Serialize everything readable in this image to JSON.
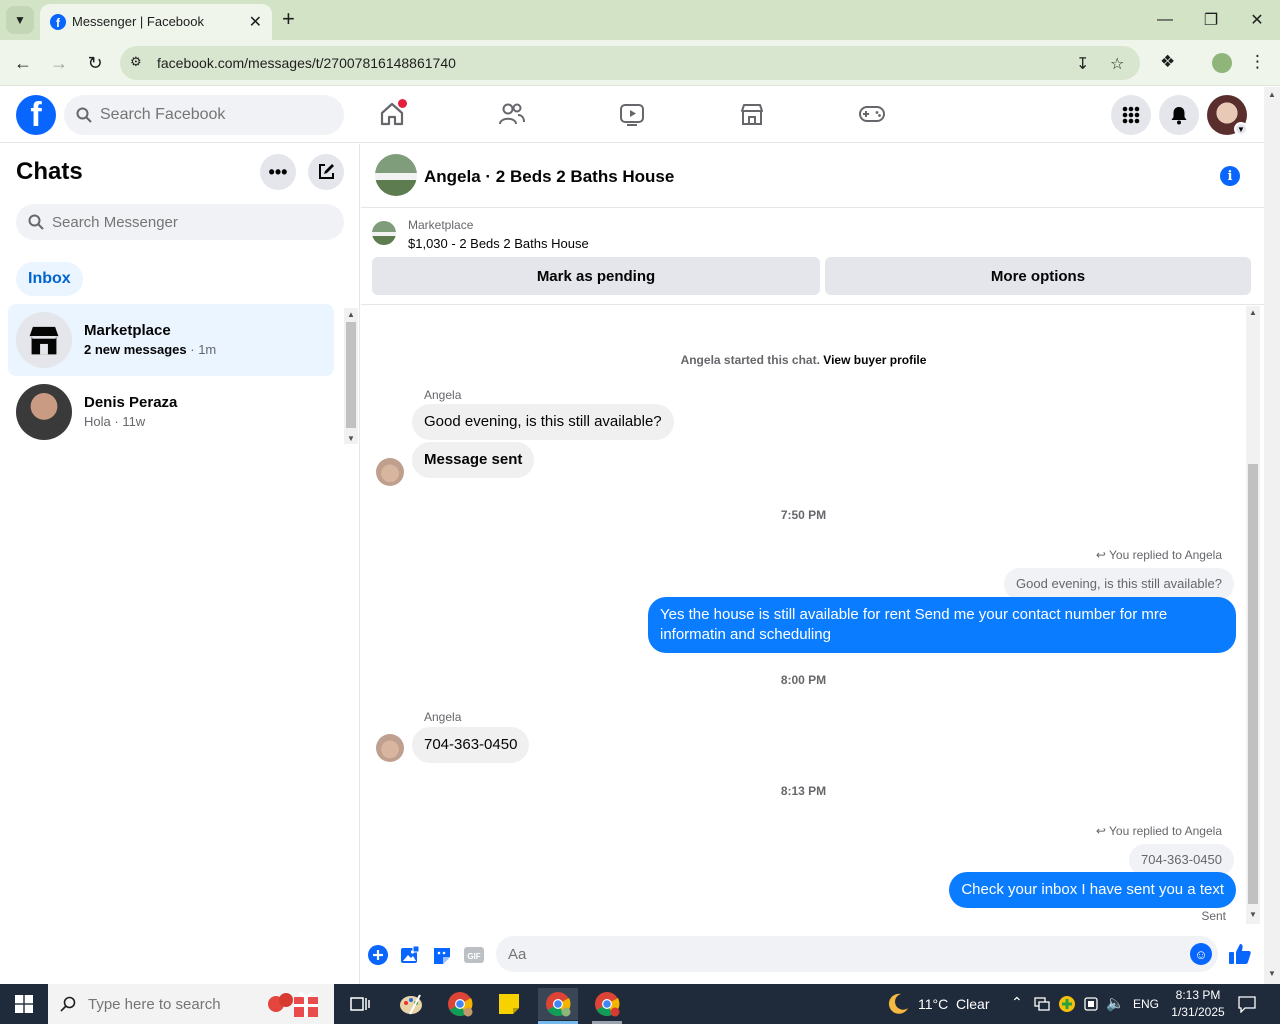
{
  "browser": {
    "tab_title": "Messenger | Facebook",
    "url": "facebook.com/messages/t/27007816148861740"
  },
  "facebook": {
    "search_placeholder": "Search Facebook",
    "brand_color": "#0866ff"
  },
  "chats_panel": {
    "title": "Chats",
    "search_placeholder": "Search Messenger",
    "inbox_label": "Inbox",
    "items": [
      {
        "name": "Marketplace",
        "preview": "2 new messages",
        "time": "1m"
      },
      {
        "name": "Denis Peraza",
        "preview": "Hola",
        "time": "11w"
      }
    ]
  },
  "conversation": {
    "title": "Angela · 2 Beds 2 Baths House",
    "marketplace_label": "Marketplace",
    "listing": "$1,030 - 2 Beds 2 Baths House",
    "mark_pending_label": "Mark as pending",
    "more_options_label": "More options",
    "started_text": "Angela started this chat.",
    "buyer_profile_link": "View buyer profile",
    "messages": {
      "sender_1": "Angela",
      "in_1": "Good evening, is this still available?",
      "in_2": "Message sent",
      "time_1": "7:50 PM",
      "reply_label_1": "You replied to Angela",
      "quote_1": "Good evening, is this still available?",
      "out_1_line1": "Yes the house is still available for rent Send me your contact number for mre",
      "out_1_line2": "informatin and  scheduling",
      "time_2": "8:00 PM",
      "sender_2": "Angela",
      "in_3": "704-363-0450",
      "time_3": "8:13 PM",
      "reply_label_2": "You replied to Angela",
      "quote_2": "704-363-0450",
      "out_2": "Check your inbox I have sent you a text",
      "status": "Sent"
    },
    "composer_placeholder": "Aa",
    "outgoing_color": "#0a7cff"
  },
  "taskbar": {
    "search_placeholder": "Type here to search",
    "weather": "11°C  Clear",
    "language": "ENG",
    "time": "8:13 PM",
    "date": "1/31/2025"
  }
}
